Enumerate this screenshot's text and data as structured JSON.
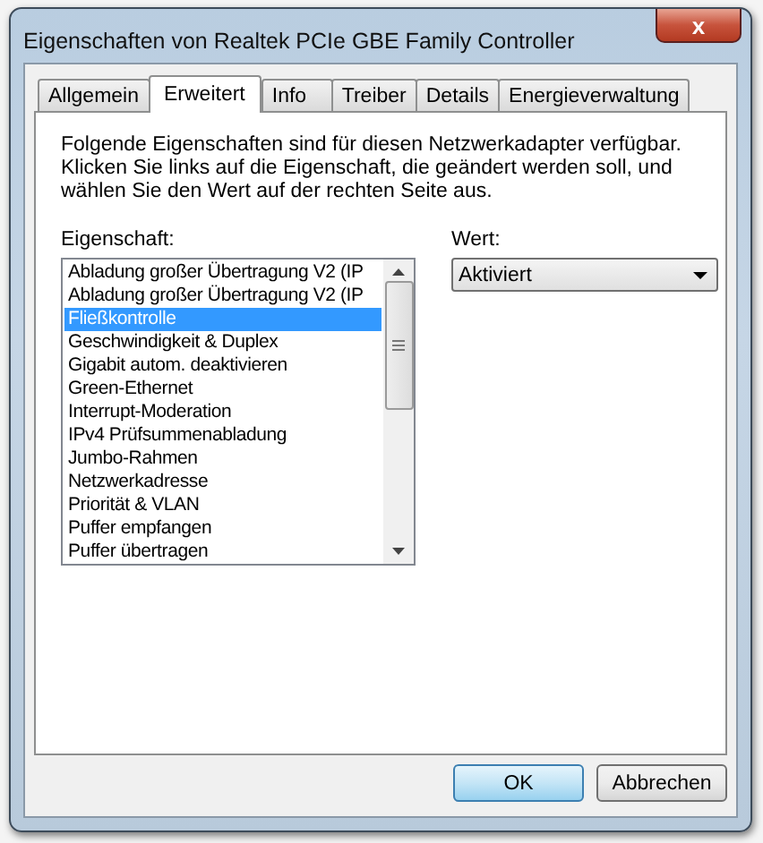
{
  "window": {
    "title": "Eigenschaften von Realtek PCIe GBE Family Controller",
    "close": "x"
  },
  "tabs": [
    {
      "label": "Allgemein",
      "selected": false
    },
    {
      "label": "Erweitert",
      "selected": true
    },
    {
      "label": "Info",
      "selected": false
    },
    {
      "label": "Treiber",
      "selected": false
    },
    {
      "label": "Details",
      "selected": false
    },
    {
      "label": "Energieverwaltung",
      "selected": false
    }
  ],
  "description": "Folgende Eigenschaften sind für diesen Netzwerkadapter verfügbar. Klicken Sie links auf die Eigenschaft, die geändert werden soll, und wählen Sie den Wert auf der rechten Seite aus.",
  "property_label": "Eigenschaft:",
  "properties": [
    {
      "label": "Abladung großer Übertragung V2 (IP",
      "selected": false
    },
    {
      "label": "Abladung großer Übertragung V2 (IP",
      "selected": false
    },
    {
      "label": "Fließkontrolle",
      "selected": true
    },
    {
      "label": "Geschwindigkeit & Duplex",
      "selected": false
    },
    {
      "label": "Gigabit autom. deaktivieren",
      "selected": false
    },
    {
      "label": "Green-Ethernet",
      "selected": false
    },
    {
      "label": "Interrupt-Moderation",
      "selected": false
    },
    {
      "label": "IPv4 Prüfsummenabladung",
      "selected": false
    },
    {
      "label": "Jumbo-Rahmen",
      "selected": false
    },
    {
      "label": "Netzwerkadresse",
      "selected": false
    },
    {
      "label": "Priorität & VLAN",
      "selected": false
    },
    {
      "label": "Puffer empfangen",
      "selected": false
    },
    {
      "label": "Puffer übertragen",
      "selected": false
    }
  ],
  "value_label": "Wert:",
  "value": "Aktiviert",
  "buttons": [
    {
      "label": "OK",
      "kind": "default"
    },
    {
      "label": "Abbrechen",
      "kind": "normal"
    }
  ]
}
